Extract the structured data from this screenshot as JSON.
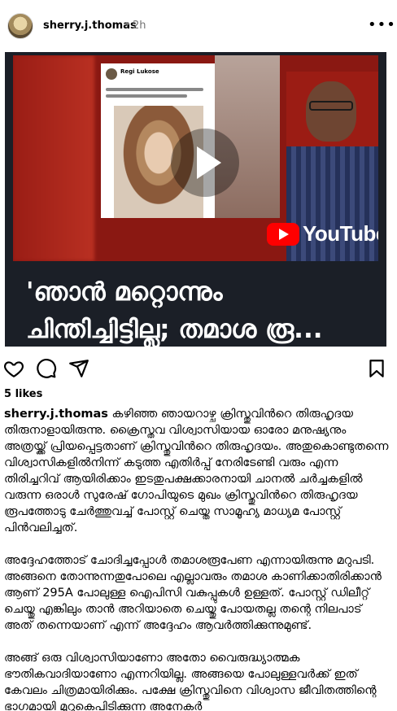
{
  "header": {
    "username": "sherry.j.thomas",
    "separator": "•",
    "time": "2h",
    "more_label": "•••"
  },
  "media": {
    "card_name": "Regi Lukose",
    "youtube_label": "YouTube",
    "headline_line1": "'ഞാൻ മറ്റൊന്നും",
    "headline_line2": "ചിന്തിച്ചിട്ടില്ല; തമാശ രൂ..."
  },
  "actions": {
    "like_icon": "heart-icon",
    "comment_icon": "comment-icon",
    "share_icon": "send-icon",
    "save_icon": "bookmark-icon"
  },
  "likes": "5 likes",
  "caption": {
    "author": "sherry.j.thomas",
    "paragraph1": "കഴിഞ്ഞ ഞായറാഴ്ച ക്രിസ്തുവിൻറെ തിരുഹൃദയ തിരുനാളായിരുന്നു. ക്രൈസ്തവ വിശ്വാസിയായ ഓരോ മനുഷ്യനും അത്രയ്ക്ക് പ്രിയപ്പെട്ടതാണ് ക്രിസ്തുവിൻറെ തിരുഹൃദയം. അതുകൊണ്ടുതന്നെ വിശ്വാസികളിൽനിന്ന് കടുത്ത എതിർപ്പ് നേരിടേണ്ടി വരും എന്ന തിരിച്ചറിവ് ആയിരിക്കാം ഇടതുപക്ഷക്കാരനായി ചാനൽ ചർച്ചകളിൽ വരുന്ന ഒരാൾ സുരേഷ് ഗോപിയുടെ മുഖം ക്രിസ്തുവിൻറെ തിരുഹൃദയ രൂപത്തോടു ചേർത്തുവച്ച് പോസ്റ്റ് ചെയ്ത സാമൂഹ്യ മാധ്യമ പോസ്റ്റ് പിൻവലിച്ചത്.",
    "paragraph2": "അദ്ദേഹത്തോട് ചോദിച്ചപ്പോൾ തമാശരൂപേണ എന്നായിരുന്നു മറുപടി. അങ്ങനെ തോന്നുന്നതുപോലെ എല്ലാവരും തമാശ കാണിക്കാതിരിക്കാൻ ആണ് 295A പോലുള്ള ഐപിസി വകുപ്പുകൾ ഉള്ളത്. പോസ്റ്റ് ഡിലീറ്റ് ചെയ്തു എങ്കിലും താൻ അറിയാതെ ചെയ്തു പോയതല്ല തന്റെ നിലപാട് അത് തന്നെയാണ് എന്ന് അദ്ദേഹം ആവർത്തിക്കുന്നുമുണ്ട്.",
    "paragraph3": "അങ്ങ് ഒരു വിശ്വാസിയാണോ അതോ വൈരുദ്ധ്യാത്മക ഭൗതികവാദിയാണോ എന്നറിയില്ല. അങ്ങയെ പോലുള്ളവർക്ക് ഇത് കേവലം ചിത്രമായിരിക്കും. പക്ഷേ ക്രിസ്തുവിനെ വിശ്വാസ ജീവിതത്തിന്റെ ഭാഗമായി മുറുകെപിടിക്കുന്ന അനേകർ"
  }
}
